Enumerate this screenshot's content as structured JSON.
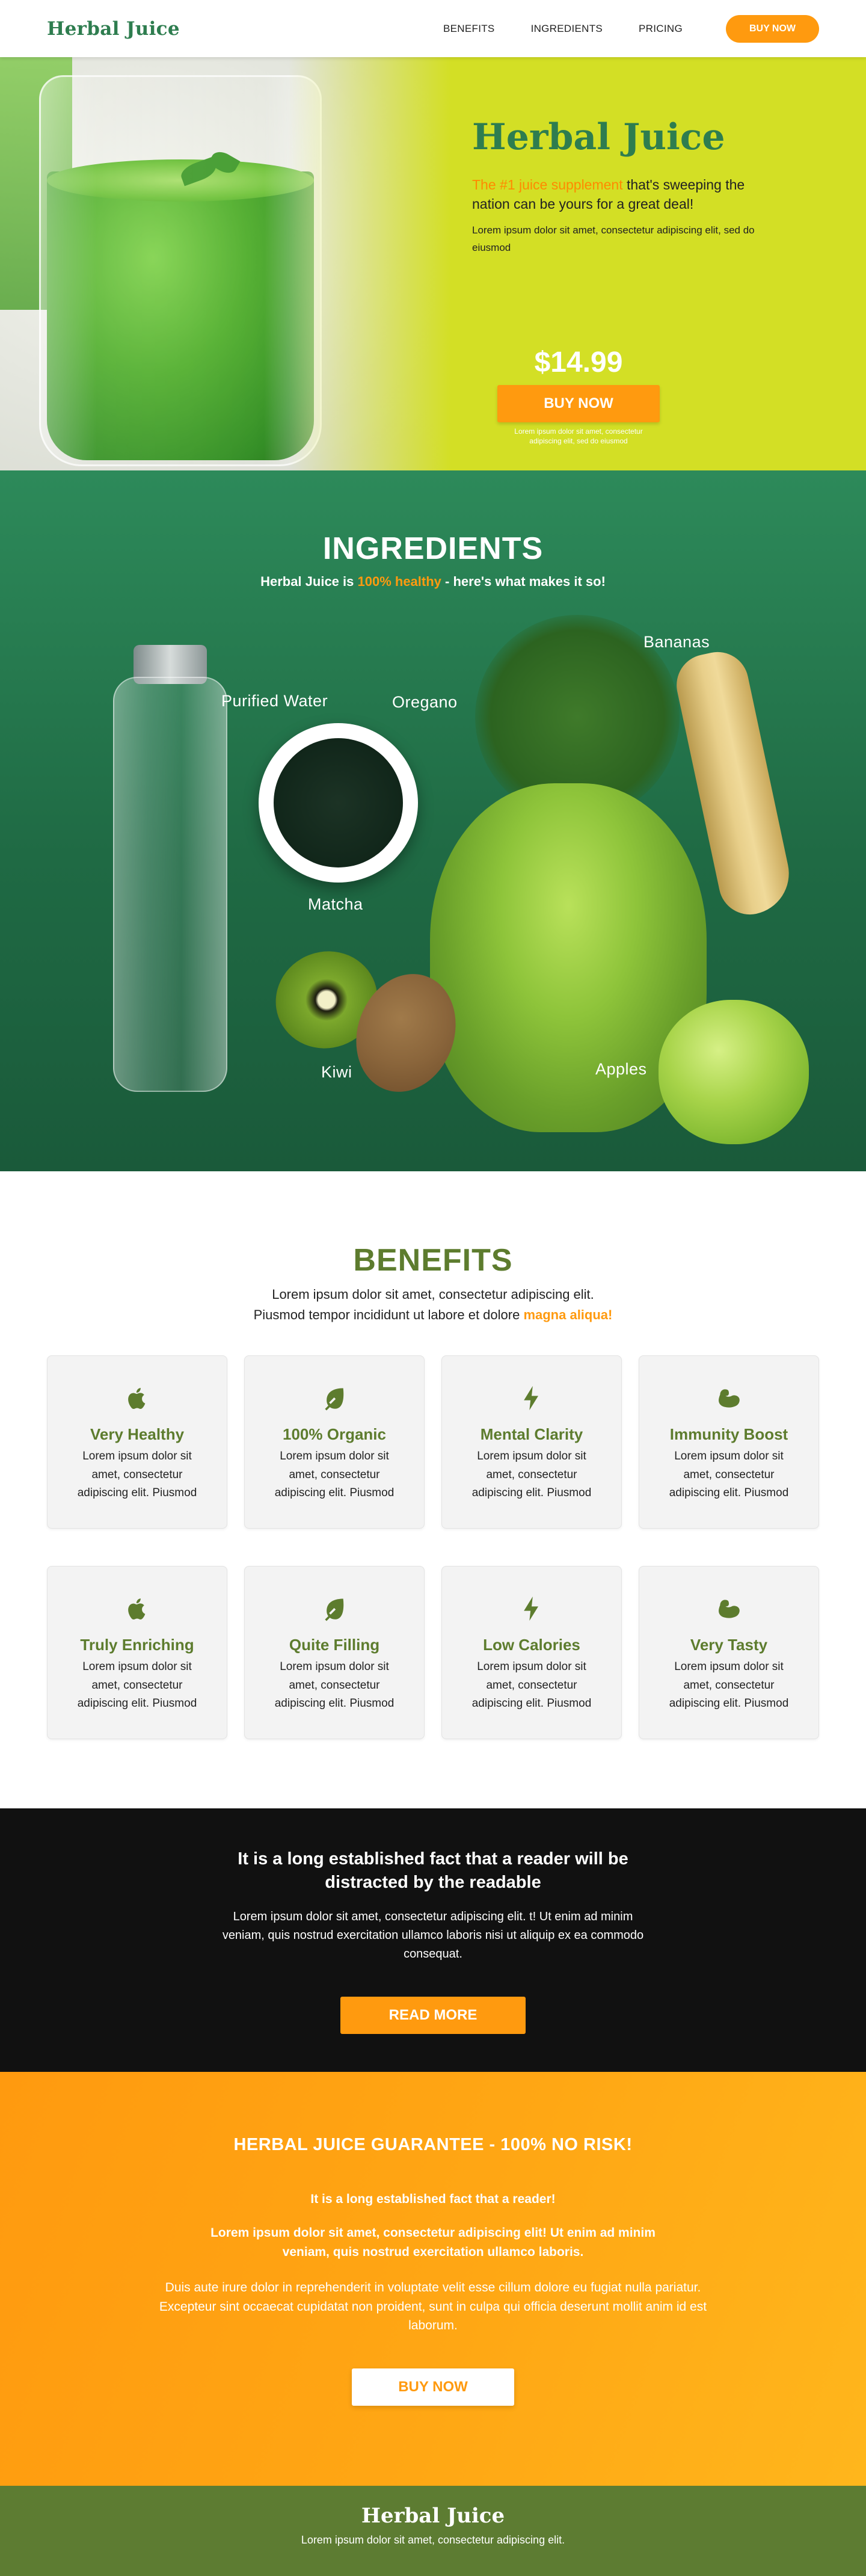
{
  "nav": {
    "logo": "Herbal Juice",
    "links": [
      "BENEFITS",
      "INGREDIENTS",
      "PRICING"
    ],
    "cta": "BUY NOW"
  },
  "hero": {
    "title": "Herbal Juice",
    "sub_highlight": "The #1 juice supplement",
    "sub_rest": " that's sweeping the nation can be yours for a great deal!",
    "text": "Lorem ipsum dolor sit amet, consectetur adipiscing elit, sed do eiusmod",
    "price": "$14.99",
    "cta": "BUY NOW",
    "fine": "Lorem ipsum dolor sit amet, consectetur adipiscing elit, sed do eiusmod"
  },
  "ingredients": {
    "title": "INGREDIENTS",
    "sub_pre": "Herbal Juice is ",
    "sub_highlight": "100% healthy",
    "sub_post": " - here's what makes it so!",
    "labels": {
      "water": "Purified Water",
      "oregano": "Oregano",
      "bananas": "Bananas",
      "matcha": "Matcha",
      "kiwi": "Kiwi",
      "apples": "Apples"
    }
  },
  "benefits": {
    "title": "BENEFITS",
    "sub_line1": "Lorem ipsum dolor sit amet, consectetur adipiscing elit.",
    "sub_line2": "Piusmod tempor incididunt ut labore et dolore ",
    "sub_highlight": "magna aliqua!",
    "cards": [
      {
        "icon": "apple-icon",
        "title": "Very Healthy",
        "text": "Lorem ipsum dolor sit amet, consectetur adipiscing elit. Piusmod"
      },
      {
        "icon": "leaf-icon",
        "title": "100% Organic",
        "text": "Lorem ipsum dolor sit amet, consectetur adipiscing elit. Piusmod"
      },
      {
        "icon": "bolt-icon",
        "title": "Mental Clarity",
        "text": "Lorem ipsum dolor sit amet, consectetur adipiscing elit. Piusmod"
      },
      {
        "icon": "muscle-icon",
        "title": "Immunity Boost",
        "text": "Lorem ipsum dolor sit amet, consectetur adipiscing elit. Piusmod"
      },
      {
        "icon": "apple-icon",
        "title": "Truly Enriching",
        "text": "Lorem ipsum dolor sit amet, consectetur adipiscing elit. Piusmod"
      },
      {
        "icon": "leaf-icon",
        "title": "Quite Filling",
        "text": "Lorem ipsum dolor sit amet, consectetur adipiscing elit. Piusmod"
      },
      {
        "icon": "bolt-icon",
        "title": "Low Calories",
        "text": "Lorem ipsum dolor sit amet, consectetur adipiscing elit. Piusmod"
      },
      {
        "icon": "muscle-icon",
        "title": "Very Tasty",
        "text": "Lorem ipsum dolor sit amet, consectetur adipiscing elit. Piusmod"
      }
    ]
  },
  "info": {
    "title": "It is a long established fact that a reader will be distracted by the readable",
    "text": "Lorem ipsum dolor sit amet, consectetur adipiscing elit. t! Ut enim ad minim veniam, quis nostrud exercitation ullamco laboris nisi ut aliquip ex ea commodo consequat.",
    "cta": "READ MORE"
  },
  "guarantee": {
    "title": "HERBAL JUICE GUARANTEE - 100% NO RISK!",
    "p1": "It is a long established fact that a reader!",
    "p2": "Lorem ipsum dolor sit amet, consectetur adipiscing elit! Ut enim ad minim veniam, quis nostrud exercitation ullamco laboris.",
    "p3": "Duis aute irure dolor in reprehenderit in voluptate velit esse cillum dolore eu fugiat nulla pariatur. Excepteur sint occaecat cupidatat non proident, sunt in culpa qui officia deserunt mollit anim id est laborum.",
    "cta": "BUY NOW"
  },
  "footer": {
    "logo": "Herbal Juice",
    "text": "Lorem ipsum dolor sit amet, consectetur adipiscing elit."
  },
  "colors": {
    "brand_green": "#2e7d4f",
    "olive": "#5d7c2e",
    "orange": "#ff9a0f",
    "lime": "#d3df25"
  }
}
